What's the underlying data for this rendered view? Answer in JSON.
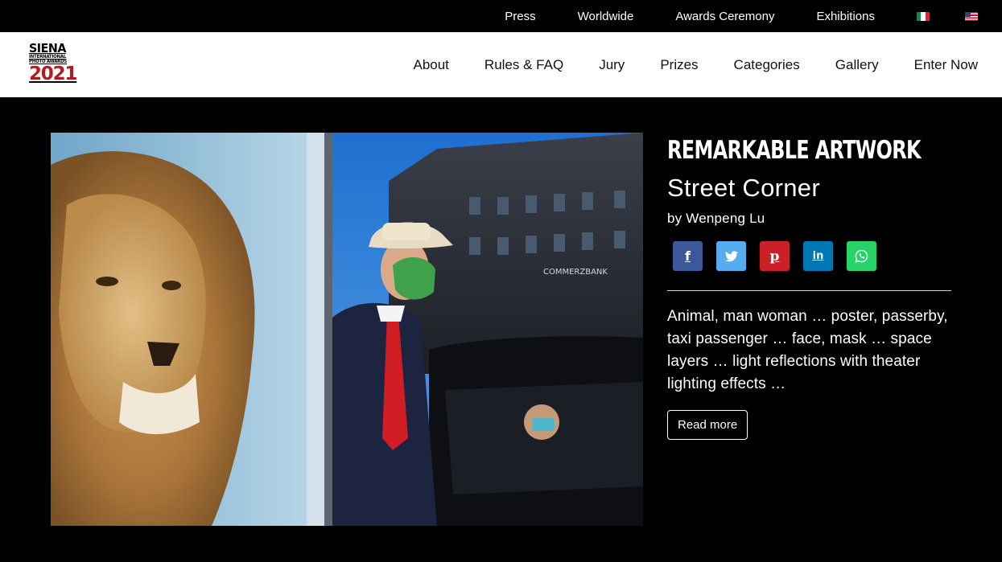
{
  "topnav": {
    "items": [
      {
        "label": "Press"
      },
      {
        "label": "Worldwide"
      },
      {
        "label": "Awards Ceremony"
      },
      {
        "label": "Exhibitions"
      }
    ],
    "flags": [
      "italian-flag-icon",
      "us-flag-icon"
    ]
  },
  "logo": {
    "line1": "SIENA",
    "line2": "INTERNATIONAL",
    "line3": "PHOTO AWARDS",
    "year": "2021",
    "year_color": "#b11c24"
  },
  "mainnav": {
    "items": [
      {
        "label": "About"
      },
      {
        "label": "Rules & FAQ"
      },
      {
        "label": "Jury"
      },
      {
        "label": "Prizes"
      },
      {
        "label": "Categories"
      },
      {
        "label": "Gallery"
      },
      {
        "label": "Enter Now"
      }
    ]
  },
  "photo": {
    "sign_text": "COMMERZBANK"
  },
  "artwork": {
    "award": "REMARKABLE ARTWORK",
    "title": "Street Corner",
    "author": "by Wenpeng Lu",
    "description": "Animal, man woman … poster, passerby, taxi passenger … face, mask … space layers … light reflections with theater lighting effects …",
    "read_more": "Read more"
  },
  "share": [
    {
      "icon": "facebook-icon",
      "color": "#3b5998",
      "glyph": "f"
    },
    {
      "icon": "twitter-icon",
      "color": "#55acee"
    },
    {
      "icon": "pinterest-icon",
      "color": "#cb2027",
      "glyph": "p"
    },
    {
      "icon": "linkedin-icon",
      "color": "#0077b5",
      "glyph": "in"
    },
    {
      "icon": "whatsapp-icon",
      "color": "#25d366"
    }
  ]
}
